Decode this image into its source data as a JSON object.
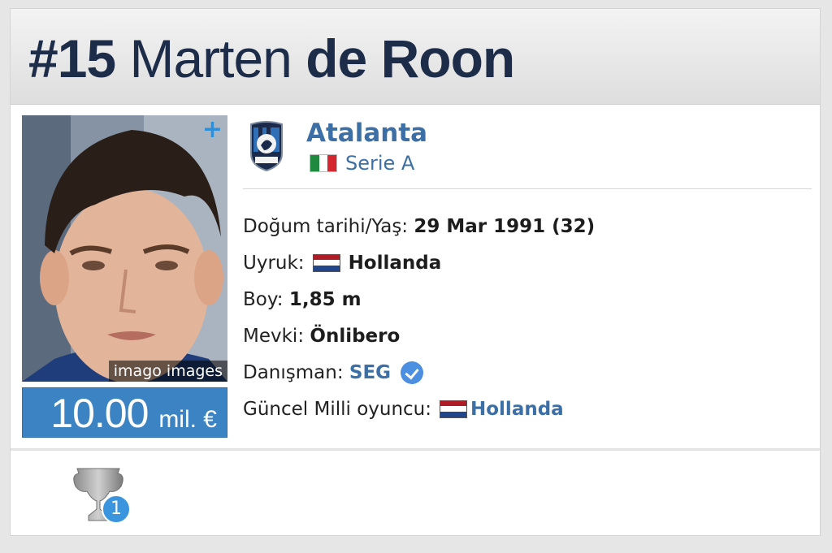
{
  "player": {
    "number": "#15",
    "first_name": "Marten",
    "last_name": "de Roon"
  },
  "photo": {
    "credit": "imago images",
    "add_icon": "plus-icon"
  },
  "market_value": {
    "amount": "10.00",
    "unit": "mil. €"
  },
  "club": {
    "name": "Atalanta",
    "logo_icon": "atalanta-crest-icon",
    "league": "Serie A",
    "league_flag": "italy-flag-icon"
  },
  "details": {
    "birth_label": "Doğum tarihi/Yaş:",
    "birth_value": "29 Mar 1991 (32)",
    "nationality_label": "Uyruk:",
    "nationality_value": "Hollanda",
    "height_label": "Boy:",
    "height_value": "1,85 m",
    "position_label": "Mevki:",
    "position_value": "Önlibero",
    "agent_label": "Danışman:",
    "agent_value": "SEG",
    "national_team_label": "Güncel Milli oyuncu:",
    "national_team_value": "Hollanda"
  },
  "achievements": {
    "trophy_icon": "trophy-icon",
    "count": "1"
  },
  "colors": {
    "title": "#1d2c49",
    "link": "#3c6fa5",
    "market_value_bg": "#3c83c3",
    "badge": "#3b94de"
  }
}
